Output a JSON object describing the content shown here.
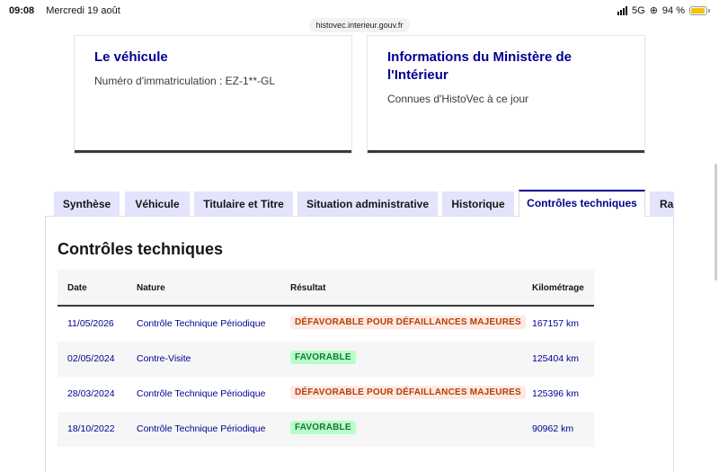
{
  "status_bar": {
    "time": "09:08",
    "date": "Mercredi 19 août",
    "network": "5G",
    "battery_text": "94 %",
    "battery_level": 0.94,
    "battery_color": "#f6c400"
  },
  "browser": {
    "url": "histovec.interieur.gouv.fr"
  },
  "cards": {
    "vehicule": {
      "title": "Le véhicule",
      "subtitle": "Numéro d'immatriculation : EZ-1**-GL"
    },
    "ministere": {
      "title": "Informations du Ministère de l'Intérieur",
      "subtitle": "Connues d'HistoVec à ce jour"
    }
  },
  "tabs": [
    {
      "label": "Synthèse",
      "active": false
    },
    {
      "label": "Véhicule",
      "active": false
    },
    {
      "label": "Titulaire et Titre",
      "active": false
    },
    {
      "label": "Situation administrative",
      "active": false
    },
    {
      "label": "Historique",
      "active": false
    },
    {
      "label": "Contrôles techniques",
      "active": true
    },
    {
      "label": "Rapport",
      "active": false
    }
  ],
  "section": {
    "title": "Contrôles techniques"
  },
  "table": {
    "headers": {
      "date": "Date",
      "nature": "Nature",
      "result": "Résultat",
      "mileage": "Kilométrage"
    },
    "rows": [
      {
        "date": "11/05/2026",
        "nature": "Contrôle Technique Périodique",
        "result": "DÉFAVORABLE POUR DÉFAILLANCES MAJEURES",
        "status": "bad",
        "mileage": "167157 km"
      },
      {
        "date": "02/05/2024",
        "nature": "Contre-Visite",
        "result": "FAVORABLE",
        "status": "good",
        "mileage": "125404 km"
      },
      {
        "date": "28/03/2024",
        "nature": "Contrôle Technique Périodique",
        "result": "DÉFAVORABLE POUR DÉFAILLANCES MAJEURES",
        "status": "bad",
        "mileage": "125396 km"
      },
      {
        "date": "18/10/2022",
        "nature": "Contrôle Technique Périodique",
        "result": "FAVORABLE",
        "status": "good",
        "mileage": "90962 km"
      }
    ]
  },
  "colors": {
    "brand_blue": "#000091",
    "tab_bg": "#e3e3fd",
    "bad_bg": "#fee9e5",
    "bad_text": "#b34000",
    "good_bg": "#b8fec9",
    "good_text": "#18753c"
  }
}
